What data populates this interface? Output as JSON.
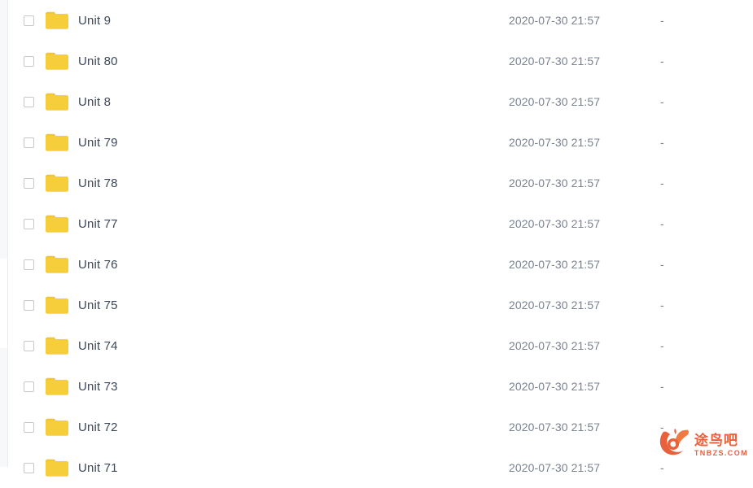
{
  "panel": {
    "background_color": "#ffffff",
    "gutter_color": "#f7f8fa",
    "divider_color": "#ececec"
  },
  "colors": {
    "folder": "#f6ce3c",
    "folder_tab": "#f2c52f",
    "name_text": "#3d4757",
    "meta_text": "#7a8290",
    "checkbox_border": "#c4c7cc",
    "watermark": "#e8603c"
  },
  "columns": {
    "select_label": "",
    "name_label": "",
    "date_label": "",
    "size_label": ""
  },
  "rows": [
    {
      "name": "Unit 9",
      "date": "2020-07-30 21:57",
      "size": "-",
      "icon": "folder-icon",
      "checked": false
    },
    {
      "name": "Unit 80",
      "date": "2020-07-30 21:57",
      "size": "-",
      "icon": "folder-icon",
      "checked": false
    },
    {
      "name": "Unit 8",
      "date": "2020-07-30 21:57",
      "size": "-",
      "icon": "folder-icon",
      "checked": false
    },
    {
      "name": "Unit 79",
      "date": "2020-07-30 21:57",
      "size": "-",
      "icon": "folder-icon",
      "checked": false
    },
    {
      "name": "Unit 78",
      "date": "2020-07-30 21:57",
      "size": "-",
      "icon": "folder-icon",
      "checked": false
    },
    {
      "name": "Unit 77",
      "date": "2020-07-30 21:57",
      "size": "-",
      "icon": "folder-icon",
      "checked": false
    },
    {
      "name": "Unit 76",
      "date": "2020-07-30 21:57",
      "size": "-",
      "icon": "folder-icon",
      "checked": false
    },
    {
      "name": "Unit 75",
      "date": "2020-07-30 21:57",
      "size": "-",
      "icon": "folder-icon",
      "checked": false
    },
    {
      "name": "Unit 74",
      "date": "2020-07-30 21:57",
      "size": "-",
      "icon": "folder-icon",
      "checked": false
    },
    {
      "name": "Unit 73",
      "date": "2020-07-30 21:57",
      "size": "-",
      "icon": "folder-icon",
      "checked": false
    },
    {
      "name": "Unit 72",
      "date": "2020-07-30 21:57",
      "size": "-",
      "icon": "folder-icon",
      "checked": false
    },
    {
      "name": "Unit 71",
      "date": "2020-07-30 21:57",
      "size": "-",
      "icon": "folder-icon",
      "checked": false
    }
  ],
  "watermark": {
    "logo_icon": "phoenix-bird-logo-icon",
    "cn_text": "途鸟吧",
    "en_text": "TNBZS.COM"
  }
}
